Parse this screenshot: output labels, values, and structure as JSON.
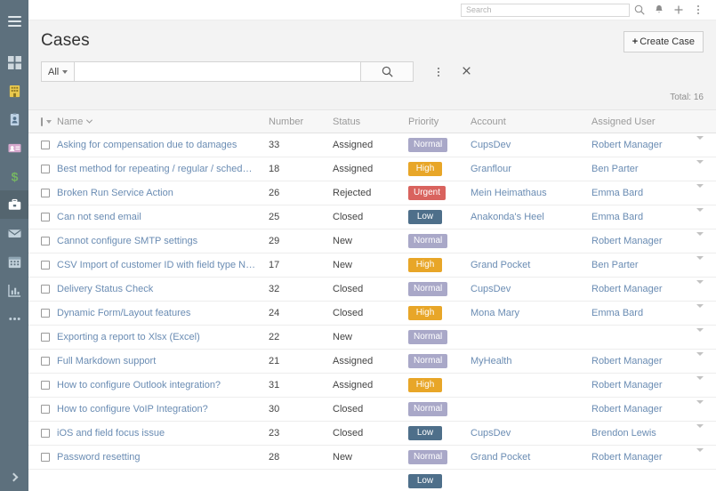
{
  "navbar": {
    "search_placeholder": "Search",
    "search_value": "",
    "icons": [
      "search-icon",
      "bell-icon",
      "plus-icon",
      "kebab-menu-icon"
    ]
  },
  "sidebar": {
    "background": "#5d707d",
    "active_background": "#54656f",
    "items": [
      {
        "name": "hamburger-menu-icon",
        "label": "Menu",
        "active": false
      },
      {
        "name": "dashboard-icon",
        "label": "Dashboard",
        "active": false
      },
      {
        "name": "accounts-building-icon",
        "label": "Accounts",
        "active": false
      },
      {
        "name": "contacts-badge-icon",
        "label": "Contacts",
        "active": false
      },
      {
        "name": "leads-card-icon",
        "label": "Leads",
        "active": false
      },
      {
        "name": "opportunities-dollar-icon",
        "label": "Opportunities",
        "active": false
      },
      {
        "name": "cases-briefcase-icon",
        "label": "Cases",
        "active": true
      },
      {
        "name": "email-envelope-icon",
        "label": "Emails",
        "active": false
      },
      {
        "name": "calendar-icon",
        "label": "Calendar",
        "active": false
      },
      {
        "name": "reports-chart-icon",
        "label": "Reports",
        "active": false
      },
      {
        "name": "more-ellipsis-icon",
        "label": "More",
        "active": false
      }
    ],
    "expand_label": "Expand"
  },
  "page": {
    "title": "Cases",
    "create_button": "Create Case",
    "create_button_plus": "+",
    "total_label": "Total: 16"
  },
  "search": {
    "scope_label": "All",
    "input_value": "",
    "input_placeholder": "",
    "search_icon": "magnifier-icon",
    "kebab_icon": "kebab-menu-icon",
    "close_icon": "close-x-icon"
  },
  "table": {
    "columns": [
      {
        "key": "checkbox",
        "label": ""
      },
      {
        "key": "name",
        "label": "Name"
      },
      {
        "key": "number",
        "label": "Number"
      },
      {
        "key": "status",
        "label": "Status"
      },
      {
        "key": "priority",
        "label": "Priority"
      },
      {
        "key": "account",
        "label": "Account"
      },
      {
        "key": "assigned_user",
        "label": "Assigned User"
      },
      {
        "key": "menu",
        "label": ""
      }
    ],
    "rows": [
      {
        "name": "Asking for compensation due to damages",
        "number": "33",
        "status": "Assigned",
        "status_class": "st-assigned",
        "priority": "Normal",
        "priority_class": "b-normal",
        "account": "CupsDev",
        "assigned_user": "Robert Manager"
      },
      {
        "name": "Best method for repeating / regular / sched…",
        "number": "18",
        "status": "Assigned",
        "status_class": "st-assigned",
        "priority": "High",
        "priority_class": "b-high",
        "account": "Granflour",
        "assigned_user": "Ben Parter"
      },
      {
        "name": "Broken Run Service Action",
        "number": "26",
        "status": "Rejected",
        "status_class": "st-rejected",
        "priority": "Urgent",
        "priority_class": "b-urgent",
        "account": "Mein Heimathaus",
        "assigned_user": "Emma Bard"
      },
      {
        "name": "Can not send email",
        "number": "25",
        "status": "Closed",
        "status_class": "st-closed",
        "priority": "Low",
        "priority_class": "b-low",
        "account": "Anakonda's Heel",
        "assigned_user": "Emma Bard"
      },
      {
        "name": "Cannot configure SMTP settings",
        "number": "29",
        "status": "New",
        "status_class": "st-new",
        "priority": "Normal",
        "priority_class": "b-normal",
        "account": "",
        "assigned_user": "Robert Manager"
      },
      {
        "name": "CSV Import of customer ID with field type N…",
        "number": "17",
        "status": "New",
        "status_class": "st-new",
        "priority": "High",
        "priority_class": "b-high",
        "account": "Grand Pocket",
        "assigned_user": "Ben Parter"
      },
      {
        "name": "Delivery Status Check",
        "number": "32",
        "status": "Closed",
        "status_class": "st-closed",
        "priority": "Normal",
        "priority_class": "b-normal",
        "account": "CupsDev",
        "assigned_user": "Robert Manager"
      },
      {
        "name": "Dynamic Form/Layout features",
        "number": "24",
        "status": "Closed",
        "status_class": "st-closed",
        "priority": "High",
        "priority_class": "b-high",
        "account": "Mona Mary",
        "assigned_user": "Emma Bard"
      },
      {
        "name": "Exporting a report to Xlsx (Excel)",
        "number": "22",
        "status": "New",
        "status_class": "st-new",
        "priority": "Normal",
        "priority_class": "b-normal",
        "account": "",
        "assigned_user": ""
      },
      {
        "name": "Full Markdown support",
        "number": "21",
        "status": "Assigned",
        "status_class": "st-assigned",
        "priority": "Normal",
        "priority_class": "b-normal",
        "account": "MyHealth",
        "assigned_user": "Robert Manager"
      },
      {
        "name": "How to configure Outlook integration?",
        "number": "31",
        "status": "Assigned",
        "status_class": "st-assigned",
        "priority": "High",
        "priority_class": "b-high",
        "account": "",
        "assigned_user": "Robert Manager"
      },
      {
        "name": "How to configure VoIP Integration?",
        "number": "30",
        "status": "Closed",
        "status_class": "st-closed",
        "priority": "Normal",
        "priority_class": "b-normal",
        "account": "",
        "assigned_user": "Robert Manager"
      },
      {
        "name": "iOS and field focus issue",
        "number": "23",
        "status": "Closed",
        "status_class": "st-closed",
        "priority": "Low",
        "priority_class": "b-low",
        "account": "CupsDev",
        "assigned_user": "Brendon Lewis"
      },
      {
        "name": "Password resetting",
        "number": "28",
        "status": "New",
        "status_class": "st-new",
        "priority": "Normal",
        "priority_class": "b-normal",
        "account": "Grand Pocket",
        "assigned_user": "Robert Manager"
      },
      {
        "name": "",
        "number": "",
        "status": "",
        "status_class": "st-new",
        "priority": "Low",
        "priority_class": "b-low",
        "account": "",
        "assigned_user": ""
      }
    ]
  },
  "colors": {
    "link": "#6a8cb3",
    "badge_normal": "#a9a8c8",
    "badge_high": "#e8a628",
    "badge_urgent": "#d9635e",
    "badge_low": "#4e6f8a",
    "status_rejected": "#d4756a",
    "status_closed": "#7aa65c"
  }
}
